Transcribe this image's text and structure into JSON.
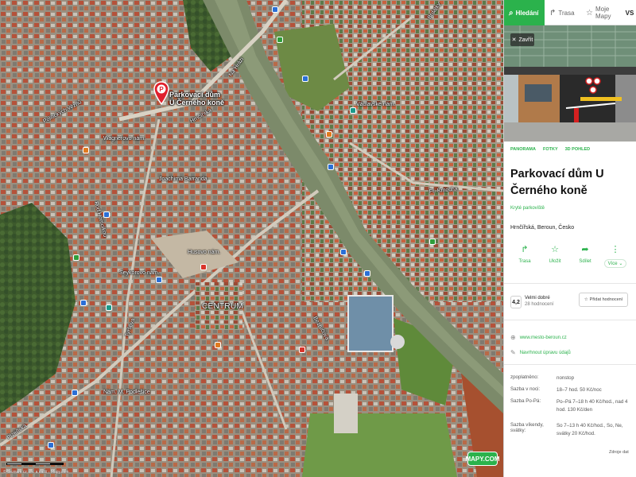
{
  "tabs": {
    "search": "Hledání",
    "route": "Trasa",
    "my_maps": "Moje Mapy",
    "avatar_initials": "VS"
  },
  "map": {
    "pin_label_line1": "Parkovací dům",
    "pin_label_line2": "U Černého koně",
    "labels": {
      "centrum": "CENTRUM",
      "husovo": "Husovo nám.",
      "seykoro": "Seykorovo nám.",
      "wagner": "Wagnerovo nám.",
      "joachima": "Joachima Barranda",
      "plzenska": "Plzeňská",
      "tyrsova": "Tyršova",
      "na_hrazi": "Na Hrázi",
      "m_podlesi": "Nám. M. Podlešice",
      "vaclavske": "Václavské nám.",
      "fk": "Fr. Kmocha",
      "hr": "Hrnčířská",
      "bez": "Bezručova",
      "pod": "Pod Homolkou",
      "brn": "Brdatky",
      "pgr": "Politických vězňů"
    },
    "logo": "MAPY.COM",
    "copyright": "© Seznam.cz a.s. a další · Mapy.com",
    "scale_label": "50 m"
  },
  "place": {
    "close_label": "Zavřít",
    "media_tabs": [
      "PANORAMA",
      "FOTKY",
      "3D POHLED"
    ],
    "title": "Parkovací dům U Černého koně",
    "category": "Kryté parkoviště",
    "address": "Hrnčířská, Beroun, Česko",
    "actions": [
      {
        "glyph": "↱",
        "label": "Trasa",
        "icon": "route-icon"
      },
      {
        "glyph": "☆",
        "label": "Uložit",
        "icon": "star-icon"
      },
      {
        "glyph": "➦",
        "label": "Sdílet",
        "icon": "share-icon"
      },
      {
        "glyph": "⋮",
        "label": "Více",
        "icon": "more-icon"
      }
    ],
    "rating_value": "4,2",
    "rating_word": "Velmi dobré",
    "rating_count": "28 hodnocení",
    "add_rating": "Přidat hodnocení",
    "website": "www.mesto-beroun.cz",
    "suggest_edit": "Navrhnout úpravu údajů",
    "info": [
      {
        "k": "zpoplatněno:",
        "v": "nonstop"
      },
      {
        "k": "Sazba v noci:",
        "v": "18–7 hod. 50 Kč/noc"
      },
      {
        "k": "Sazba Po-Pá:",
        "v": "Po–Pá 7–18 h 40 Kč/hod., nad 4 hod. 130 Kč/den"
      },
      {
        "k": "Sazba víkendy, svátky:",
        "v": "So 7–13 h 40 Kč/hod., So, Ne, svátky 20 Kč/hod."
      }
    ],
    "more_info": "Zdroje dat"
  },
  "colors": {
    "accent": "#2bb24c",
    "pin": "#e0202c"
  }
}
